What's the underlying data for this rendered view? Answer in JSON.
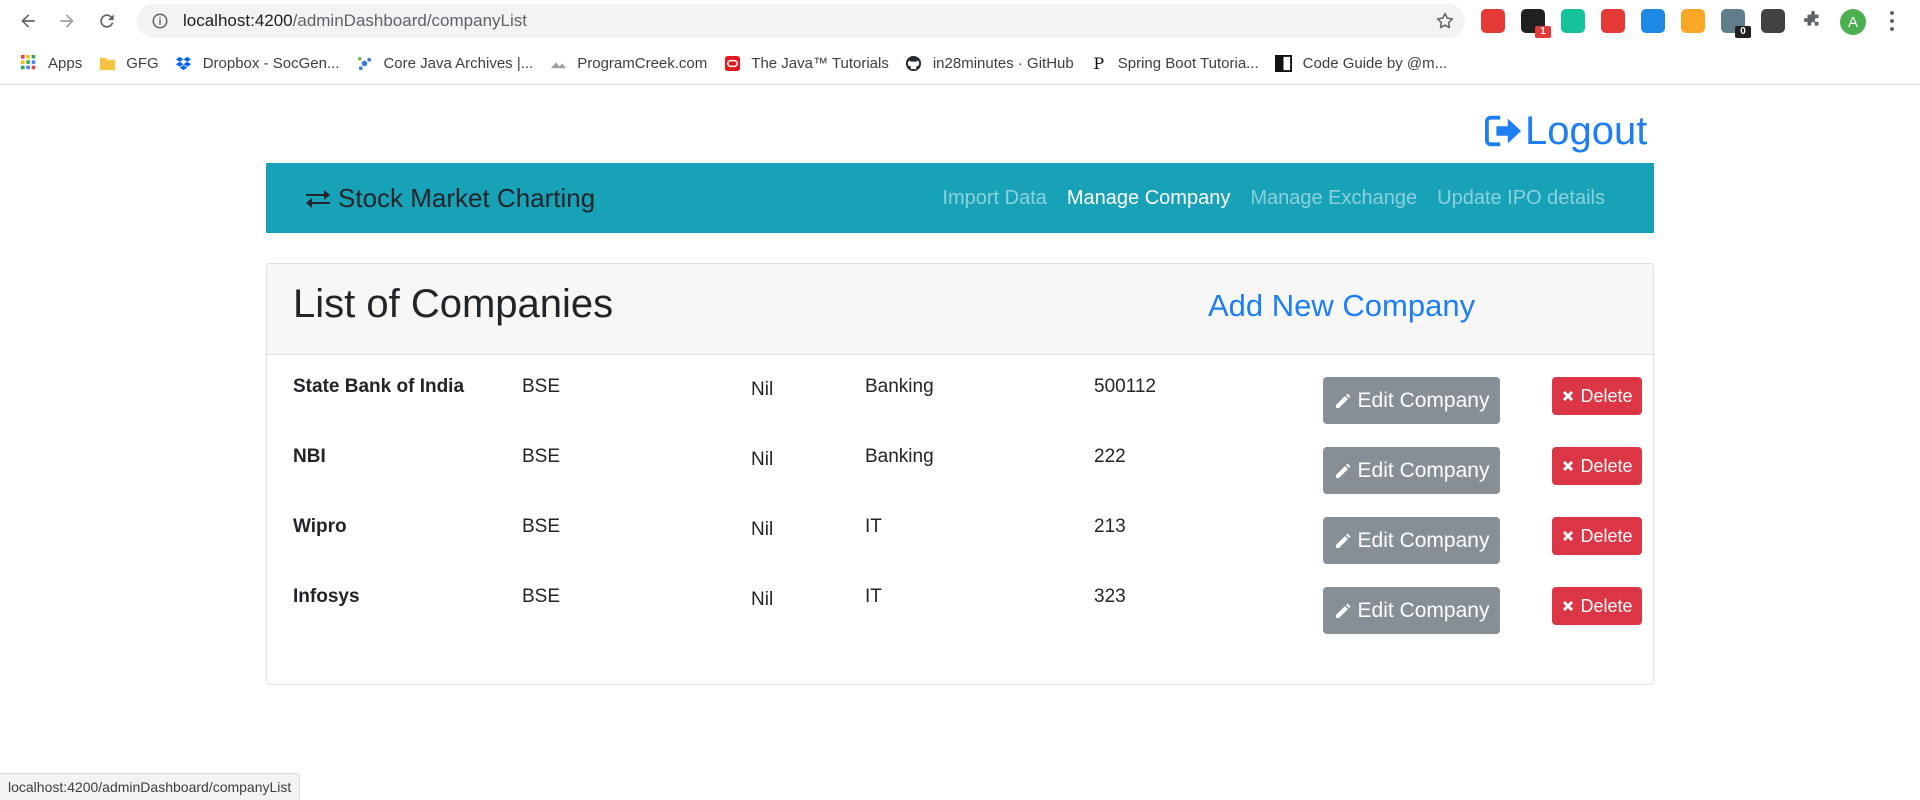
{
  "browser": {
    "url_host": "localhost:4200",
    "url_path": "/adminDashboard/companyList",
    "avatar_letter": "A",
    "extensions": [
      {
        "name": "adblock-icon",
        "color": "#e53935",
        "badge": ""
      },
      {
        "name": "reader-icon",
        "color": "#212121",
        "badge": "1",
        "badge_color": "#e53935"
      },
      {
        "name": "grammarly-icon",
        "color": "#15c39a",
        "badge": ""
      },
      {
        "name": "video-icon",
        "color": "#e53935",
        "badge": ""
      },
      {
        "name": "calendar-icon",
        "color": "#1e88e5",
        "badge": ""
      },
      {
        "name": "moon-icon",
        "color": "#f9a825",
        "badge": ""
      },
      {
        "name": "privacy-icon",
        "color": "#607d8b",
        "badge": "0",
        "badge_color": "#212121"
      },
      {
        "name": "selenium-icon",
        "color": "#424242",
        "badge": ""
      },
      {
        "name": "puzzle-icon",
        "color": "#5f6368",
        "badge": ""
      }
    ]
  },
  "bookmarks": [
    {
      "label": "Apps",
      "icon": "apps-grid-icon"
    },
    {
      "label": "GFG",
      "icon": "folder-icon"
    },
    {
      "label": "Dropbox - SocGen...",
      "icon": "dropbox-icon"
    },
    {
      "label": "Core Java Archives |...",
      "icon": "java-icon"
    },
    {
      "label": "ProgramCreek.com",
      "icon": "programcreek-icon"
    },
    {
      "label": "The Java™ Tutorials",
      "icon": "oracle-icon"
    },
    {
      "label": "in28minutes · GitHub",
      "icon": "github-icon"
    },
    {
      "label": "Spring Boot Tutoria...",
      "icon": "p-icon"
    },
    {
      "label": "Code Guide by @m...",
      "icon": "codeguide-icon"
    }
  ],
  "page": {
    "logout_label": "Logout",
    "brand": "Stock Market Charting",
    "nav": [
      "Import Data",
      "Manage Company",
      "Manage Exchange",
      "Update IPO details"
    ],
    "active_nav": "Manage Company",
    "card_title": "List of Companies",
    "add_label": "Add New Company",
    "edit_label": "Edit Company",
    "delete_label": "Delete",
    "companies": [
      {
        "name": "State Bank of India",
        "exchange": "BSE",
        "ceo": "Nil",
        "sector": "Banking",
        "code": "500112"
      },
      {
        "name": "NBI",
        "exchange": "BSE",
        "ceo": "Nil",
        "sector": "Banking",
        "code": "222"
      },
      {
        "name": "Wipro",
        "exchange": "BSE",
        "ceo": "Nil",
        "sector": "IT",
        "code": "213"
      },
      {
        "name": "Infosys",
        "exchange": "BSE",
        "ceo": "Nil",
        "sector": "IT",
        "code": "323"
      }
    ]
  },
  "status_bar": "localhost:4200/adminDashboard/companyList",
  "colors": {
    "navbar": "#17a2b8",
    "link": "#1e7ef5",
    "edit_button": "#868e96",
    "delete_button": "#dc3545"
  }
}
